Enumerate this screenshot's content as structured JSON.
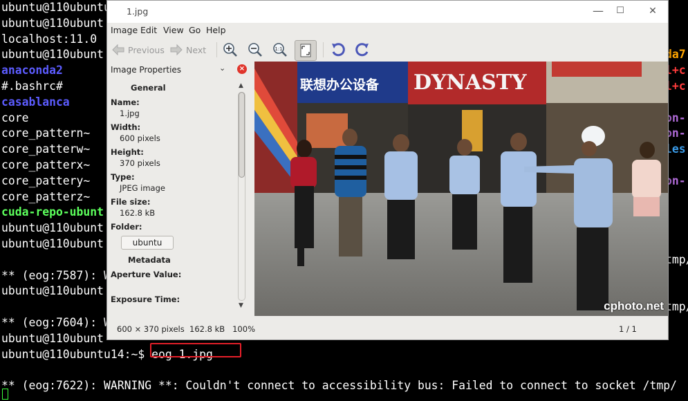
{
  "terminal": {
    "lines": [
      {
        "text": "ubuntu@110ubuntu",
        "cls": "t-white"
      },
      {
        "text": "ubuntu@110ubunt",
        "cls": "t-white"
      },
      {
        "text": "localhost:11.0",
        "cls": "t-white"
      },
      {
        "text": "ubuntu@110ubunt",
        "cls": "t-white"
      },
      {
        "text": "anaconda2",
        "cls": "t-blue"
      },
      {
        "text": "#.bashrc#",
        "cls": "t-white"
      },
      {
        "text": "casablanca",
        "cls": "t-blue"
      },
      {
        "text": "core",
        "cls": "t-white"
      },
      {
        "text": "core_pattern~",
        "cls": "t-white"
      },
      {
        "text": "core_patterw~",
        "cls": "t-white"
      },
      {
        "text": "core_patterx~",
        "cls": "t-white"
      },
      {
        "text": "core_pattery~",
        "cls": "t-white"
      },
      {
        "text": "core_patterz~",
        "cls": "t-white"
      },
      {
        "text": "cuda-repo-ubunt",
        "cls": "t-green"
      },
      {
        "text": "ubuntu@110ubunt",
        "cls": "t-white"
      },
      {
        "text": "ubuntu@110ubunt",
        "cls": "t-white"
      },
      {
        "text": "",
        "cls": "t-white"
      },
      {
        "text": "** (eog:7587): W",
        "cls": "t-white"
      },
      {
        "text": "ubuntu@110ubunt",
        "cls": "t-white"
      },
      {
        "text": "",
        "cls": "t-white"
      },
      {
        "text": "** (eog:7604): W",
        "cls": "t-white"
      },
      {
        "text": "ubuntu@110ubunt",
        "cls": "t-white"
      },
      {
        "text": "ubuntu@110ubuntu14:~$ eog 1.jpg",
        "cls": "t-white"
      },
      {
        "text": "",
        "cls": "t-white"
      },
      {
        "text": "** (eog:7622): WARNING **: Couldn't connect to accessibility bus: Failed to connect to socket /tmp/",
        "cls": "t-white"
      }
    ],
    "right_lines": [
      {
        "text": "da7",
        "cls": "t-orange",
        "row": 3
      },
      {
        "text": "l+c",
        "cls": "t-red",
        "row": 4
      },
      {
        "text": "l+c",
        "cls": "t-red",
        "row": 5
      },
      {
        "text": "on-",
        "cls": "t-purple",
        "row": 7
      },
      {
        "text": "on-",
        "cls": "t-purple",
        "row": 8
      },
      {
        "text": "les",
        "cls": "t-cyan",
        "row": 9
      },
      {
        "text": "on-",
        "cls": "t-purple",
        "row": 11
      },
      {
        "text": "tmp/",
        "cls": "t-white",
        "row": 16
      },
      {
        "text": "tmp/",
        "cls": "t-white",
        "row": 19
      }
    ]
  },
  "window": {
    "title": "1.jpg",
    "minimize": "—",
    "maximize": "☐",
    "close": "✕"
  },
  "menu": [
    "Image",
    "Edit",
    "View",
    "Go",
    "Help"
  ],
  "toolbar": {
    "previous": "Previous",
    "next": "Next"
  },
  "sidebar": {
    "header": "Image Properties",
    "general": "General",
    "name_label": "Name:",
    "name_value": "1.jpg",
    "width_label": "Width:",
    "width_value": "600 pixels",
    "height_label": "Height:",
    "height_value": "370 pixels",
    "type_label": "Type:",
    "type_value": "JPEG image",
    "filesize_label": "File size:",
    "filesize_value": "162.8 kB",
    "folder_label": "Folder:",
    "folder_button": "ubuntu",
    "metadata": "Metadata",
    "aperture_label": "Aperture Value:",
    "exposure_label": "Exposure Time:"
  },
  "image": {
    "watermark": "cphoto.net",
    "sign_1": "联想办公设备",
    "sign_2": "DYNASTY"
  },
  "status": {
    "info": "600 × 370 pixels  162.8 kB   100%",
    "page": "1 / 1"
  },
  "colors": {
    "terminal_bg": "#000000",
    "highlight": "#e8202a",
    "window_bg": "#ecebe8"
  }
}
